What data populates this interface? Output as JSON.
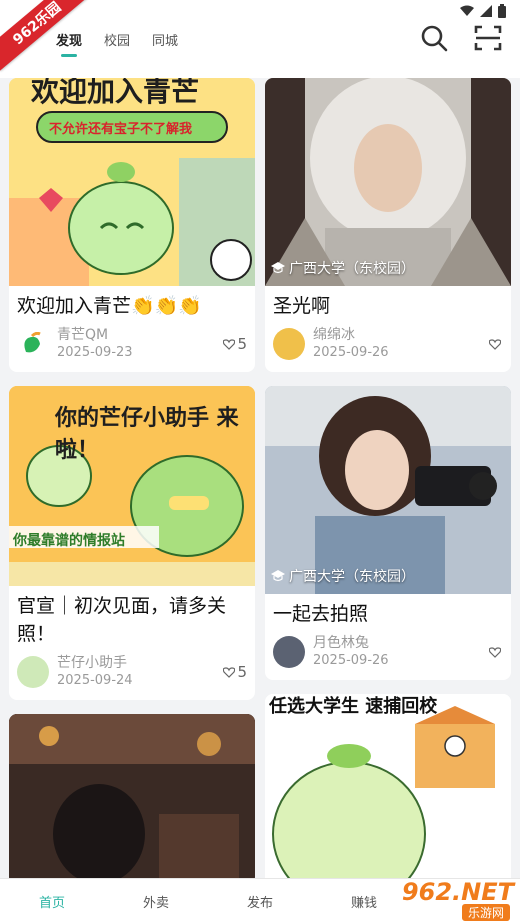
{
  "corner_badge": "962乐园",
  "header": {
    "tabs": [
      {
        "label": "发现",
        "active": true
      },
      {
        "label": "校园",
        "active": false
      },
      {
        "label": "同城",
        "active": false
      }
    ],
    "icons": [
      "search-icon",
      "scan-icon"
    ]
  },
  "status_icons": [
    "wifi-icon",
    "signal-icon",
    "battery-icon"
  ],
  "feed": {
    "left": [
      {
        "image_text": "欢迎加入青芒",
        "image_sub": "不允许还有宝子不了解我",
        "title": "欢迎加入青芒👏👏👏",
        "user": "青芒QM",
        "date": "2025-09-23",
        "likes": "5",
        "avatar_color": "#7fcf6b"
      },
      {
        "image_text": "你的芒仔小助手 来啦！",
        "image_sub": "你最靠谱的情报站",
        "title": "官宣｜初次见面，请多关照！",
        "user": "芒仔小助手",
        "date": "2025-09-24",
        "likes": "5",
        "avatar_color": "#cfe9b8"
      },
      {
        "title": "",
        "user": "",
        "date": "",
        "likes": ""
      }
    ],
    "right": [
      {
        "location": "广西大学（东校园）",
        "title": "圣光啊",
        "user": "绵绵冰",
        "date": "2025-09-26",
        "likes": "",
        "avatar_color": "#f0c04a"
      },
      {
        "location": "广西大学（东校园）",
        "title": "一起去拍照",
        "user": "月色林兔",
        "date": "2025-09-26",
        "likes": "",
        "avatar_color": "#5b6272"
      },
      {
        "image_text": "任选大学生 速捕回校",
        "title": "",
        "user": "",
        "date": "",
        "likes": ""
      }
    ]
  },
  "bottom_nav": [
    {
      "label": "首页",
      "active": true
    },
    {
      "label": "外卖",
      "active": false
    },
    {
      "label": "发布",
      "active": false
    },
    {
      "label": "赚钱",
      "active": false
    }
  ],
  "watermark": {
    "brand": "962.NET",
    "sub": "乐游网"
  },
  "colors": {
    "accent": "#2bb3a3",
    "badge": "#d9262c"
  }
}
